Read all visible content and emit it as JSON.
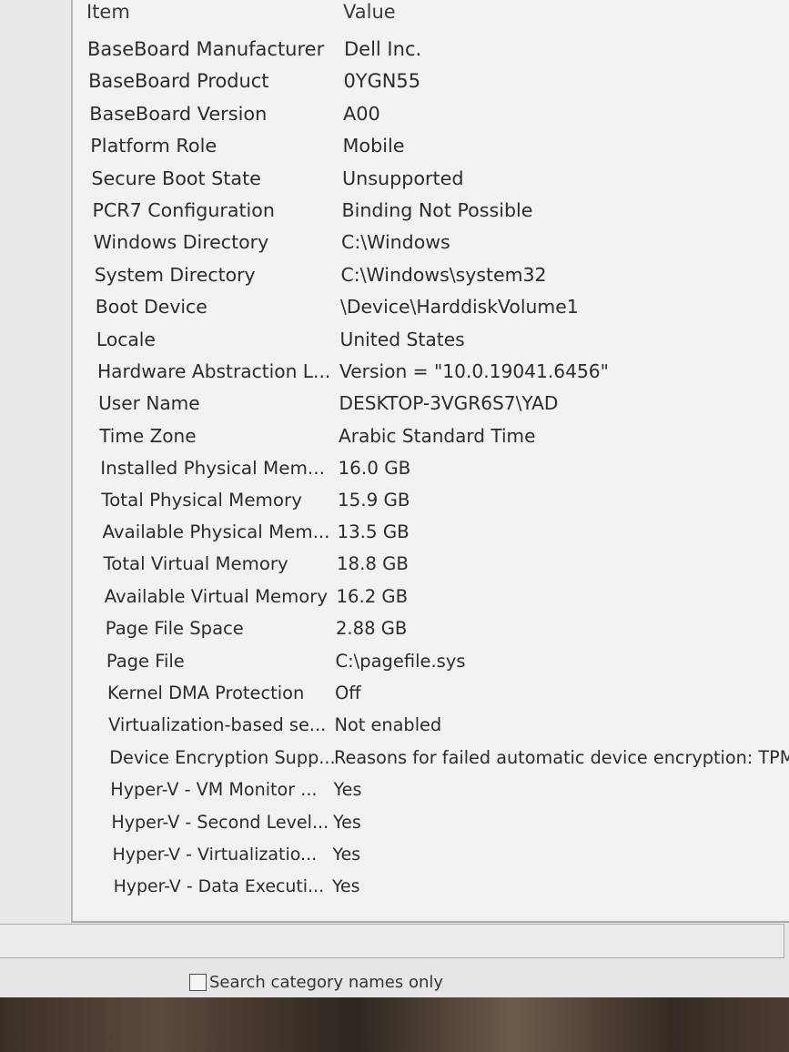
{
  "table": {
    "headers": {
      "item": "Item",
      "value": "Value"
    },
    "rows": [
      {
        "item": "BaseBoard Manufacturer",
        "value": "Dell Inc."
      },
      {
        "item": "BaseBoard Product",
        "value": "0YGN55"
      },
      {
        "item": "BaseBoard Version",
        "value": "A00"
      },
      {
        "item": "Platform Role",
        "value": "Mobile"
      },
      {
        "item": "Secure Boot State",
        "value": "Unsupported"
      },
      {
        "item": "PCR7 Configuration",
        "value": "Binding Not Possible"
      },
      {
        "item": "Windows Directory",
        "value": "C:\\Windows"
      },
      {
        "item": "System Directory",
        "value": "C:\\Windows\\system32"
      },
      {
        "item": "Boot Device",
        "value": "\\Device\\HarddiskVolume1"
      },
      {
        "item": "Locale",
        "value": "United States"
      },
      {
        "item": "Hardware Abstraction L...",
        "value": "Version = \"10.0.19041.6456\""
      },
      {
        "item": "User Name",
        "value": "DESKTOP-3VGR6S7\\YAD"
      },
      {
        "item": "Time Zone",
        "value": "Arabic Standard Time"
      },
      {
        "item": "Installed Physical Mem...",
        "value": "16.0 GB"
      },
      {
        "item": "Total Physical Memory",
        "value": "15.9 GB"
      },
      {
        "item": "Available Physical Mem...",
        "value": "13.5 GB"
      },
      {
        "item": "Total Virtual Memory",
        "value": "18.8 GB"
      },
      {
        "item": "Available Virtual Memory",
        "value": "16.2 GB"
      },
      {
        "item": "Page File Space",
        "value": "2.88 GB"
      },
      {
        "item": "Page File",
        "value": "C:\\pagefile.sys"
      },
      {
        "item": "Kernel DMA Protection",
        "value": "Off"
      },
      {
        "item": "Virtualization-based se...",
        "value": "Not enabled"
      },
      {
        "item": "Device Encryption Supp...",
        "value": "Reasons for failed automatic device encryption: TPM"
      },
      {
        "item": "Hyper-V - VM Monitor ...",
        "value": "Yes"
      },
      {
        "item": "Hyper-V - Second Level...",
        "value": "Yes"
      },
      {
        "item": "Hyper-V - Virtualizatio...",
        "value": "Yes"
      },
      {
        "item": "Hyper-V - Data Executi...",
        "value": "Yes"
      }
    ]
  },
  "find": {
    "search_category_label": "Search category names only"
  },
  "colors": {
    "table_bg": "#f2f2f4",
    "window_bg": "#e9e8ea",
    "text": "#2c2c30"
  }
}
